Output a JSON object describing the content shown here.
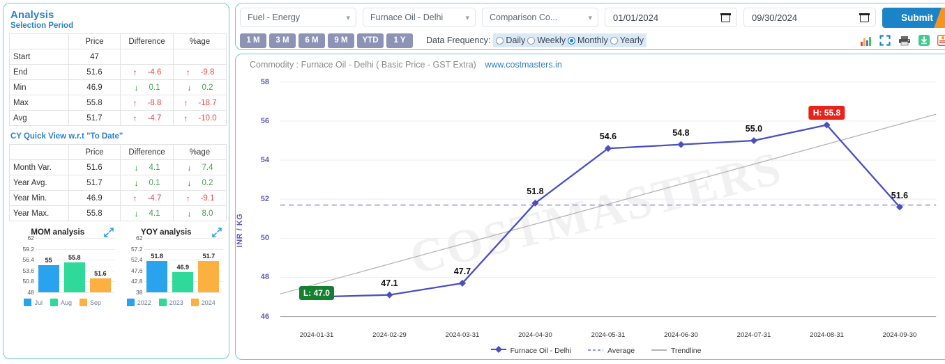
{
  "sidebar": {
    "title": "Analysis",
    "selection_period_heading": "Selection Period",
    "cy_heading": "CY Quick View w.r.t \"To Date\"",
    "columns": [
      "",
      "Price",
      "Difference",
      "%age"
    ],
    "selection_rows": [
      {
        "label": "Start",
        "price": "47",
        "diff_dir": "",
        "diff": "",
        "pct_dir": "",
        "pct": ""
      },
      {
        "label": "End",
        "price": "51.6",
        "diff_dir": "up",
        "diff": "-4.6",
        "pct_dir": "up",
        "pct": "-9.8"
      },
      {
        "label": "Min",
        "price": "46.9",
        "diff_dir": "down",
        "diff": "0.1",
        "pct_dir": "down",
        "pct": "0.2"
      },
      {
        "label": "Max",
        "price": "55.8",
        "diff_dir": "up",
        "diff": "-8.8",
        "pct_dir": "up",
        "pct": "-18.7"
      },
      {
        "label": "Avg",
        "price": "51.7",
        "diff_dir": "up",
        "diff": "-4.7",
        "pct_dir": "up",
        "pct": "-10.0"
      }
    ],
    "cy_rows": [
      {
        "label": "Month Var.",
        "price": "51.6",
        "diff_dir": "down",
        "diff": "4.1",
        "pct_dir": "down",
        "pct": "7.4"
      },
      {
        "label": "Year Avg.",
        "price": "51.7",
        "diff_dir": "down",
        "diff": "0.1",
        "pct_dir": "down",
        "pct": "0.2"
      },
      {
        "label": "Year Min.",
        "price": "46.9",
        "diff_dir": "up",
        "diff": "-4.7",
        "pct_dir": "up",
        "pct": "-9.1"
      },
      {
        "label": "Year Max.",
        "price": "55.8",
        "diff_dir": "down",
        "diff": "4.1",
        "pct_dir": "down",
        "pct": "8.0"
      }
    ]
  },
  "toolbar": {
    "category_select": "Fuel - Energy",
    "commodity_select": "Furnace Oil - Delhi",
    "comparison_select": "Comparison Co...",
    "from_date": "01/01/2024",
    "to_date": "09/30/2024",
    "submit_label": "Submit",
    "period_buttons": [
      "1 M",
      "3 M",
      "6 M",
      "9 M",
      "YTD",
      "1 Y"
    ],
    "frequency_label": "Data Frequency:",
    "frequency_options": [
      "Daily",
      "Weekly",
      "Monthly",
      "Yearly"
    ],
    "frequency_selected": "Monthly",
    "icons": [
      "bar-chart-icon",
      "fullscreen-icon",
      "print-icon",
      "download-icon",
      "export-icon"
    ],
    "colors": {
      "submit_bg": "#1b84c9",
      "submit_accent": "#f59520",
      "period_btn": "#8c93b5"
    }
  },
  "chart_header": {
    "commodity_text": "Commodity : Furnace Oil - Delhi ( Basic Price - GST Extra)",
    "site_link": "www.costmasters.in",
    "watermark": "COSTMASTERS"
  },
  "chart_data": {
    "type": "line",
    "title": "Commodity : Furnace Oil - Delhi ( Basic Price - GST Extra)",
    "xlabel": "",
    "ylabel": "INR / KG",
    "ylim": [
      46,
      58
    ],
    "yticks": [
      46,
      48,
      50,
      52,
      54,
      56,
      58
    ],
    "grid": true,
    "legend_position": "bottom",
    "categories": [
      "2024-01-31",
      "2024-02-29",
      "2024-03-31",
      "2024-04-30",
      "2024-05-31",
      "2024-06-30",
      "2024-07-31",
      "2024-08-31",
      "2024-09-30"
    ],
    "series": [
      {
        "name": "Furnace Oil - Delhi",
        "color": "#4a4fbf",
        "style": "solid-marker",
        "values": [
          47.0,
          47.1,
          47.7,
          51.8,
          54.6,
          54.8,
          55.0,
          55.8,
          51.6
        ],
        "labels": [
          "47.0",
          "47.1",
          "47.7",
          "51.8",
          "54.6",
          "54.8",
          "55.0",
          "55.8",
          "51.6"
        ]
      },
      {
        "name": "Average",
        "color": "#8f93d6",
        "style": "dashed",
        "value": 51.7
      },
      {
        "name": "Trendline",
        "color": "#b4b4b4",
        "style": "solid",
        "start": 47.15,
        "end": 56.35
      }
    ],
    "annotations": [
      {
        "kind": "low-badge",
        "text": "L: 47.0",
        "index": 0,
        "bg": "#15802f"
      },
      {
        "kind": "high-badge",
        "text": "H: 55.8",
        "index": 7,
        "bg": "#e8231a"
      }
    ]
  },
  "mini_charts": [
    {
      "id": "mom",
      "type": "bar",
      "title": "MOM analysis",
      "categories": [
        "Jul",
        "Aug",
        "Sep"
      ],
      "values": [
        55,
        55.8,
        51.6
      ],
      "labels": [
        "55",
        "55.8",
        "51.6"
      ],
      "colors": [
        "#2aa3ef",
        "#2fd99a",
        "#fcb040"
      ],
      "ylim": [
        48,
        62
      ],
      "yticks": [
        "62",
        "59.2",
        "56.4",
        "53.6",
        "50.8",
        "48"
      ]
    },
    {
      "id": "yoy",
      "type": "bar",
      "title": "YOY analysis",
      "categories": [
        "2022",
        "2023",
        "2024"
      ],
      "values": [
        51.8,
        46.9,
        51.7
      ],
      "labels": [
        "51.8",
        "46.9",
        "51.7"
      ],
      "colors": [
        "#2aa3ef",
        "#2fd99a",
        "#fcb040"
      ],
      "ylim": [
        38,
        62
      ],
      "yticks": [
        "62",
        "57.2",
        "52.4",
        "47.6",
        "42.8",
        "38"
      ]
    }
  ]
}
